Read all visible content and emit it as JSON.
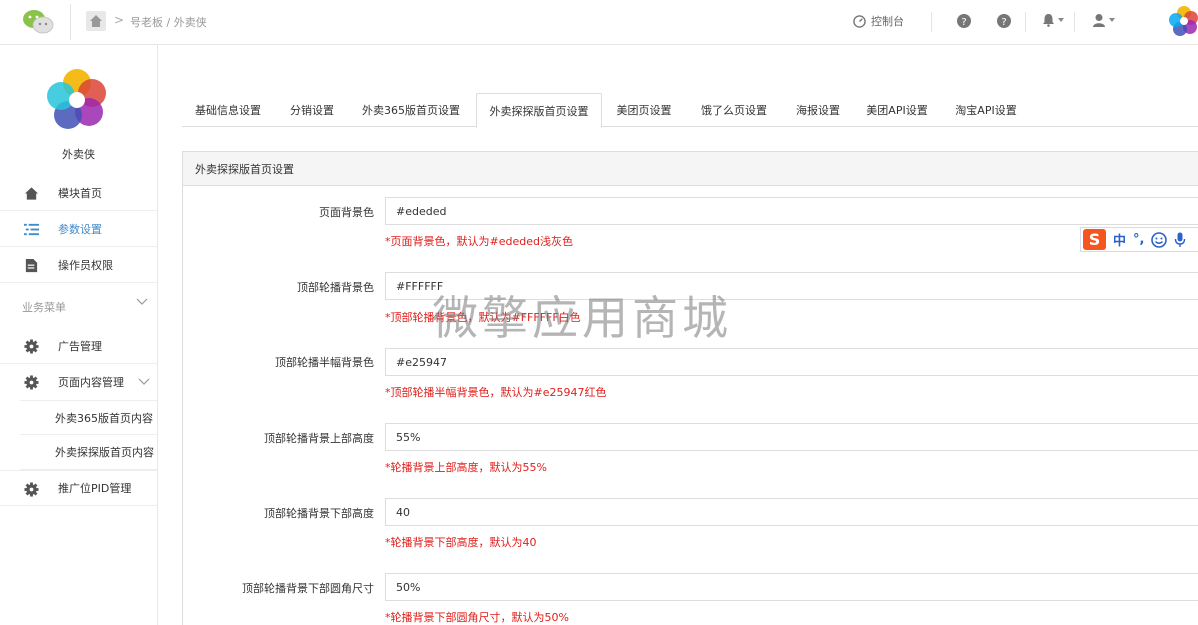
{
  "colors": {
    "accent": "#428bca",
    "hint": "#e0201c",
    "border": "#dddddd",
    "ime_brand": "#f5551e"
  },
  "topbar": {
    "breadcrumb_arrow": ">",
    "breadcrumb": "号老板 / 外卖侠",
    "console_label": "控制台",
    "icons": [
      "wechat-logo-icon",
      "home-icon",
      "dashboard-icon",
      "help-icon",
      "help-icon",
      "bell-icon",
      "user-icon",
      "app-logo-icon"
    ]
  },
  "sidebar": {
    "brand_name": "外卖侠",
    "items": [
      {
        "label": "模块首页",
        "icon": "home-icon"
      },
      {
        "label": "参数设置",
        "icon": "list-icon"
      },
      {
        "label": "操作员权限",
        "icon": "document-icon"
      }
    ],
    "group_label": "业务菜单",
    "group_items": [
      {
        "label": "广告管理",
        "icon": "gear-icon"
      },
      {
        "label": "页面内容管理",
        "icon": "gear-icon"
      },
      {
        "label": "推广位PID管理",
        "icon": "gear-icon"
      }
    ],
    "sub_items": [
      "外卖365版首页内容",
      "外卖探探版首页内容"
    ]
  },
  "tabs": [
    "基础信息设置",
    "分销设置",
    "外卖365版首页设置",
    "外卖探探版首页设置",
    "美团页设置",
    "饿了么页设置",
    "海报设置",
    "美团API设置",
    "淘宝API设置"
  ],
  "active_tab": 3,
  "panel": {
    "title": "外卖探探版首页设置",
    "fields": [
      {
        "label": "页面背景色",
        "value": "#ededed",
        "hint": "*页面背景色，默认为#ededed浅灰色"
      },
      {
        "label": "顶部轮播背景色",
        "value": "#FFFFFF",
        "hint": "*顶部轮播背景色，默认为#FFFFFF白色"
      },
      {
        "label": "顶部轮播半幅背景色",
        "value": "#e25947",
        "hint": "*顶部轮播半幅背景色，默认为#e25947红色"
      },
      {
        "label": "顶部轮播背景上部高度",
        "value": "55%",
        "hint": "*轮播背景上部高度，默认为55%"
      },
      {
        "label": "顶部轮播背景下部高度",
        "value": "40",
        "hint": "*轮播背景下部高度，默认为40"
      },
      {
        "label": "顶部轮播背景下部圆角尺寸",
        "value": "50%",
        "hint": "*轮播背景下部圆角尺寸，默认为50%"
      }
    ]
  },
  "watermark": "微擎应用商城",
  "ime": {
    "brand": "S",
    "mode": "中",
    "punct": "°,"
  }
}
